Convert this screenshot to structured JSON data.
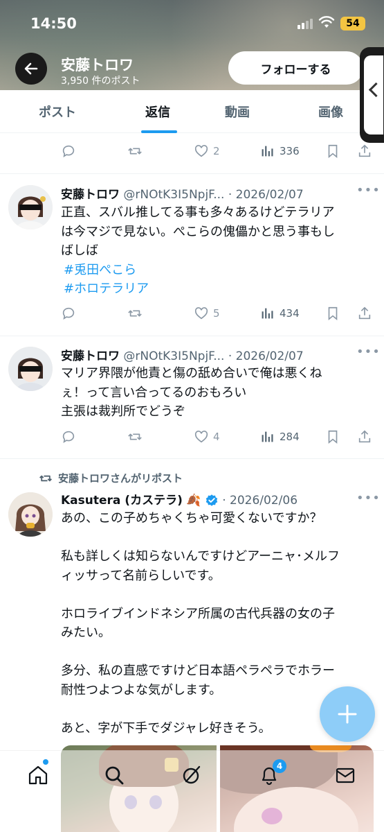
{
  "status_bar": {
    "time": "14:50",
    "battery": "54"
  },
  "header": {
    "name": "安藤トロワ",
    "post_count": "3,950 件のポスト",
    "follow_label": "フォローする"
  },
  "tabs": [
    {
      "label": "ポスト",
      "active": false
    },
    {
      "label": "返信",
      "active": true
    },
    {
      "label": "動画",
      "active": false
    },
    {
      "label": "画像",
      "active": false
    }
  ],
  "top_tweet_actions": {
    "likes": "2",
    "views": "336"
  },
  "tweets": [
    {
      "name": "安藤トロワ",
      "handle": "@rNOtK3I5NpjF...",
      "date": "· 2026/02/07",
      "lines": [
        "正直、スバル推してる事も多々あるけどテラリア",
        "は今マジで見ない。ぺこらの傀儡かと思う事もし",
        "ばしば"
      ],
      "hashtags": [
        "#兎田ぺこら",
        "#ホロテラリア"
      ],
      "likes": "5",
      "views": "434"
    },
    {
      "name": "安藤トロワ",
      "handle": "@rNOtK3I5NpjF...",
      "date": "· 2026/02/07",
      "lines": [
        "マリア界隈が他責と傷の舐め合いで俺は悪くね",
        "ぇ！って言い合ってるのおもろい",
        "主張は裁判所でどうぞ"
      ],
      "likes": "4",
      "views": "284"
    },
    {
      "repost_label": "安藤トロワさんがリポスト",
      "name": "Kasutera (カステラ)",
      "date": "· 2026/02/06",
      "lines": [
        "あの、この子めちゃくちゃ可愛くないですか？",
        "",
        "私も詳しくは知らないんですけどアーニャ･メルフ",
        "ィッサって名前らしいです。",
        "",
        "ホロライブインドネシア所属の古代兵器の女の子",
        "みたい。",
        "",
        "多分、私の直感ですけど日本語ペラペラでホラー",
        "耐性つよつよな気がします。",
        "",
        "あと、字が下手でダジャレ好きそう。"
      ]
    }
  ],
  "bottom_nav": {
    "notification_count": "4"
  },
  "colors": {
    "accent": "#1d9bf0",
    "text": "#0f1419",
    "muted": "#536471",
    "fab": "#8ecdf8"
  }
}
